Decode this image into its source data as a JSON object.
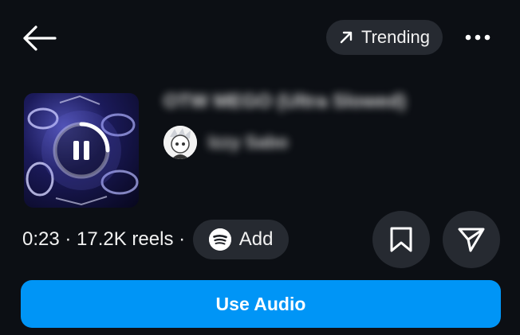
{
  "header": {
    "back_icon": "arrow-left-icon",
    "trending_label": "Trending",
    "trending_icon": "arrow-up-right-icon",
    "more_icon": "more-horizontal-icon"
  },
  "audio": {
    "title": "OTW MEGO (Ultra Slowed)",
    "artist": "Izzy Sabo",
    "state": "playing",
    "duration": "0:23",
    "reels_count": "17.2K reels",
    "meta": "0:23 · 17.2K reels ·"
  },
  "actions": {
    "add_label": "Add",
    "spotify_icon": "spotify-icon",
    "save_icon": "bookmark-icon",
    "share_icon": "send-icon",
    "use_audio_label": "Use Audio"
  },
  "colors": {
    "background": "#0c0f14",
    "pill": "#262a31",
    "primary": "#0095f6",
    "text": "#ffffff"
  }
}
